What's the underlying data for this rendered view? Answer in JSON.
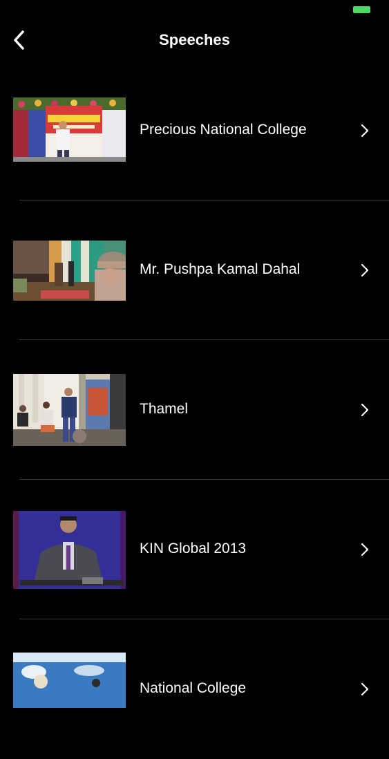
{
  "status_bar": {
    "battery_color": "#4cd964"
  },
  "nav": {
    "title": "Speeches",
    "back_icon": "chevron-left-icon"
  },
  "speeches": [
    {
      "title": "Precious National College",
      "thumbnail": "stage-programme-banner"
    },
    {
      "title": "Mr. Pushpa Kamal Dahal",
      "thumbnail": "hall-with-dhaka-topi-speaker"
    },
    {
      "title": "Thamel",
      "thumbnail": "speaker-with-microphone-room"
    },
    {
      "title": "KIN Global 2013",
      "thumbnail": "speaker-at-podium-purple"
    },
    {
      "title": "National College",
      "thumbnail": "blue-stage-banner"
    }
  ],
  "colors": {
    "background": "#000000",
    "text": "#ffffff",
    "separator": "#3a3a3c",
    "chevron": "#ffffff"
  }
}
